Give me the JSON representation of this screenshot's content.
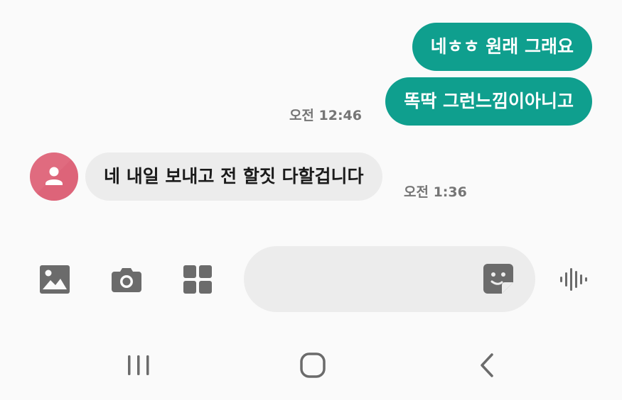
{
  "messages": {
    "outgoing": [
      {
        "text": "네ㅎㅎ 원래 그래요"
      },
      {
        "text": "똑딱 그런느낌이아니고"
      }
    ],
    "outgoing_time": "오전 12:46",
    "incoming": {
      "text": "네 내일 보내고 전 할짓 다할겁니다",
      "time": "오전 1:36"
    }
  },
  "composer": {
    "placeholder": "",
    "value": ""
  },
  "icons": {
    "gallery": "image-icon",
    "camera": "camera-icon",
    "apps": "grid-icon",
    "sticker": "sticker-icon",
    "voice": "voice-wave-icon",
    "avatar": "person-icon"
  },
  "colors": {
    "outgoing_bubble": "#0f9f8e",
    "incoming_bubble": "#ececec",
    "avatar_bg": "#e06b7f",
    "icon_gray": "#6b6b6b"
  }
}
